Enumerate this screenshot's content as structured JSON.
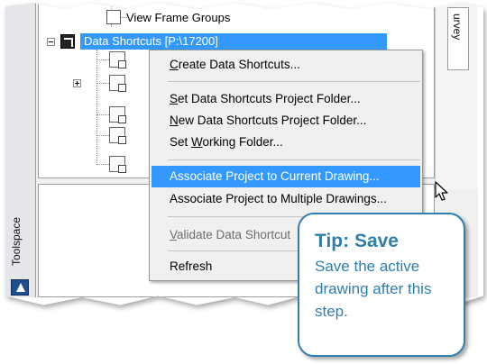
{
  "tree": {
    "view_frame_groups": "View Frame Groups",
    "data_shortcuts": "Data Shortcuts [P:\\17200]"
  },
  "side_tabs": {
    "toolspace": "Toolspace",
    "survey": "urvey"
  },
  "menu": {
    "items": [
      {
        "label_pre": "",
        "label_u": "C",
        "label_post": "reate Data Shortcuts..."
      },
      {
        "label_pre": "",
        "label_u": "S",
        "label_post": "et Data Shortcuts Project Folder..."
      },
      {
        "label_pre": "",
        "label_u": "N",
        "label_post": "ew Data Shortcuts Project Folder..."
      },
      {
        "label_pre": "Set ",
        "label_u": "W",
        "label_post": "orking Folder..."
      },
      {
        "label_pre": "Associate Project to Current Drawing...",
        "label_u": "",
        "label_post": ""
      },
      {
        "label_pre": "Associate Project to Multiple Drawings...",
        "label_u": "",
        "label_post": ""
      },
      {
        "label_pre": "",
        "label_u": "V",
        "label_post": "alidate Data Shortcut"
      },
      {
        "label_pre": "Refresh",
        "label_u": "",
        "label_post": ""
      }
    ],
    "highlighted_index": 4
  },
  "tip": {
    "title": "Tip: Save",
    "body": "Save the active drawing after this step."
  },
  "colors": {
    "selection": "#3399ff",
    "tip_accent": "#2f7fae"
  }
}
